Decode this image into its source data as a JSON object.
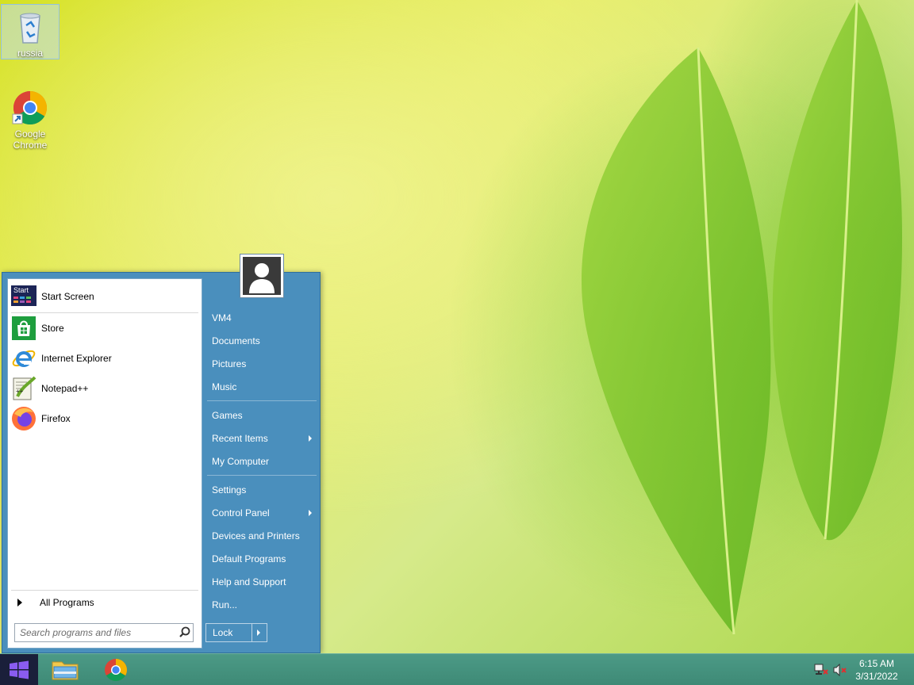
{
  "desktop": {
    "icons": [
      {
        "label": "russia",
        "icon": "recycle-bin-icon"
      },
      {
        "label": "Google Chrome",
        "icon": "chrome-icon"
      }
    ]
  },
  "start_menu": {
    "pinned": [
      {
        "label": "Start Screen",
        "icon": "start-screen-icon",
        "icon_text": "Start"
      },
      {
        "label": "Store",
        "icon": "store-icon"
      },
      {
        "label": "Internet Explorer",
        "icon": "internet-explorer-icon"
      },
      {
        "label": "Notepad++",
        "icon": "notepadpp-icon"
      },
      {
        "label": "Firefox",
        "icon": "firefox-icon"
      }
    ],
    "all_programs": "All Programs",
    "search_placeholder": "Search programs and files",
    "right_items": [
      {
        "label": "VM4"
      },
      {
        "label": "Documents"
      },
      {
        "label": "Pictures"
      },
      {
        "label": "Music"
      },
      {
        "label": "Games"
      },
      {
        "label": "Recent Items",
        "submenu": true
      },
      {
        "label": "My Computer"
      },
      {
        "label": "Settings"
      },
      {
        "label": "Control Panel",
        "submenu": true
      },
      {
        "label": "Devices and Printers"
      },
      {
        "label": "Default Programs"
      },
      {
        "label": "Help and Support"
      },
      {
        "label": "Run..."
      }
    ],
    "lock_label": "Lock"
  },
  "taskbar": {
    "apps": [
      {
        "icon": "file-explorer-icon"
      },
      {
        "icon": "chrome-icon"
      }
    ],
    "tray": [
      {
        "icon": "network-icon"
      },
      {
        "icon": "volume-muted-icon"
      }
    ],
    "time": "6:15 AM",
    "date": "3/31/2022"
  },
  "colors": {
    "start_menu_blue": "#4a8fbd",
    "taskbar": "#4c9a86",
    "start_button": "#1a1f3a"
  }
}
